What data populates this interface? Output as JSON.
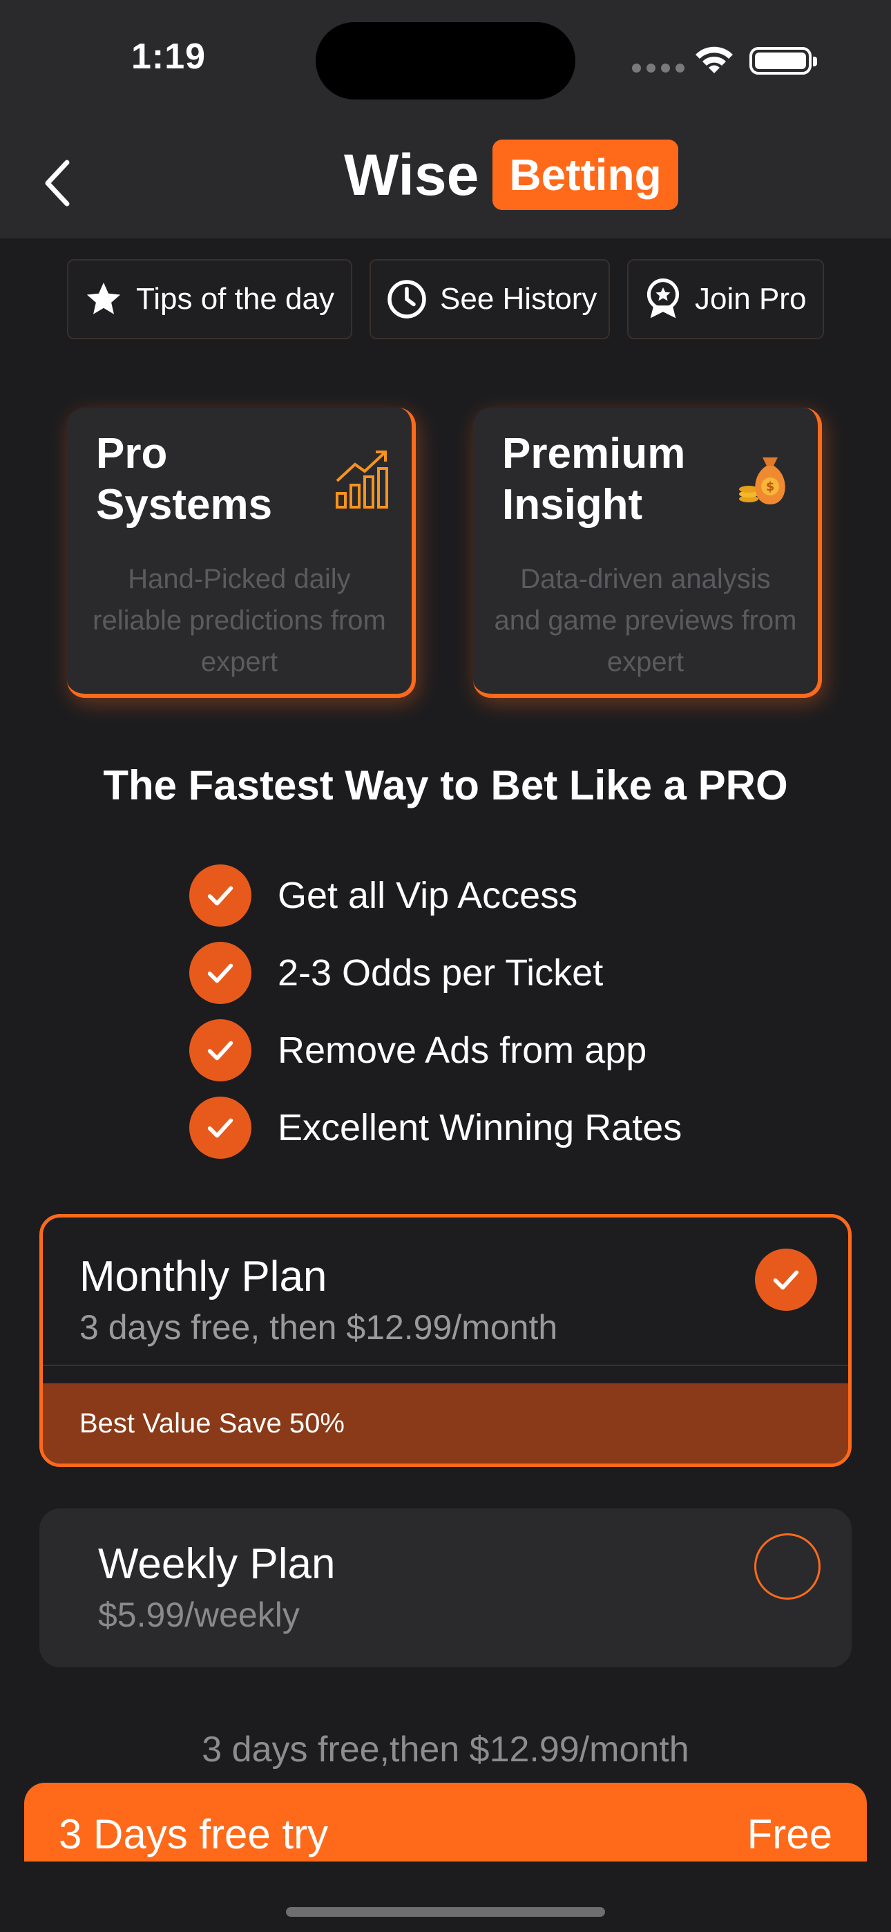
{
  "status_bar": {
    "time": "1:19"
  },
  "header": {
    "logo_word": "Wise",
    "logo_badge": "Betting"
  },
  "pills": [
    {
      "label": "Tips of the day",
      "icon": "star-icon"
    },
    {
      "label": "See History",
      "icon": "clock-icon"
    },
    {
      "label": "Join Pro",
      "icon": "award-icon"
    }
  ],
  "features": [
    {
      "title": "Pro Systems",
      "description": "Hand-Picked daily reliable predictions from expert",
      "icon": "chart-growth-icon"
    },
    {
      "title": "Premium Insight",
      "description": "Data-driven analysis and game previews from expert",
      "icon": "money-bag-icon"
    }
  ],
  "headline": "The Fastest Way to Bet Like a PRO",
  "benefits": [
    "Get all Vip Access",
    "2-3 Odds per Ticket",
    "Remove Ads from app",
    "Excellent Winning Rates"
  ],
  "plans": {
    "monthly": {
      "name": "Monthly Plan",
      "subtitle": "3 days free, then $12.99/month",
      "banner": "Best Value Save 50%",
      "selected": true
    },
    "weekly": {
      "name": "Weekly Plan",
      "subtitle": "$5.99/weekly",
      "selected": false
    }
  },
  "trial_note": "3 days free,then $12.99/month",
  "cta": {
    "left_label": "3 Days free try",
    "right_label": "Free"
  },
  "colors": {
    "accent": "#ff6a1a",
    "background": "#1c1c1f",
    "card": "#2a2a2d",
    "banner": "#8a3a18"
  }
}
